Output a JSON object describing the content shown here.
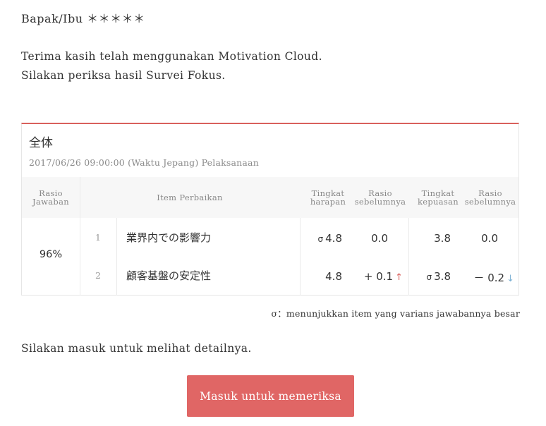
{
  "greeting": "Bapak/Ibu ＊＊＊＊＊",
  "intro": {
    "line1": "Terima kasih telah menggunakan Motivation Cloud.",
    "line2": "Silakan periksa hasil Survei Fokus."
  },
  "card": {
    "title": "全体",
    "date": "2017/06/26 09:00:00 (Waktu Jepang) Pelaksanaan",
    "headers": {
      "rate": [
        "Rasio",
        "Jawaban"
      ],
      "item": "Item Perbaikan",
      "expectation": [
        "Tingkat",
        "harapan"
      ],
      "prev1": [
        "Rasio",
        "sebelumnya"
      ],
      "satisfaction": [
        "Tingkat",
        "kepuasan"
      ],
      "prev2": [
        "Rasio",
        "sebelumnya"
      ]
    },
    "response_rate": "96%",
    "rows": [
      {
        "num": "1",
        "name": "業界内での影響力",
        "expectation_sigma": "σ",
        "expectation": "4.8",
        "prev_expectation": "0.0",
        "prev_expectation_arrow": "",
        "satisfaction_sigma": "",
        "satisfaction": "3.8",
        "prev_satisfaction": "0.0",
        "prev_satisfaction_arrow": ""
      },
      {
        "num": "2",
        "name": "顧客基盤の安定性",
        "expectation_sigma": "",
        "expectation": "4.8",
        "prev_expectation": "+ 0.1",
        "prev_expectation_arrow": "↑",
        "satisfaction_sigma": "σ",
        "satisfaction": "3.8",
        "prev_satisfaction": "－ 0.2",
        "prev_satisfaction_arrow": "↓"
      }
    ],
    "note": "σ：menunjukkan item yang varians jawabannya besar"
  },
  "cta": {
    "text": "Silakan masuk untuk melihat detailnya.",
    "button": "Masuk untuk memeriksa"
  },
  "colors": {
    "accent": "#e06665",
    "card_top_border": "#d9605c",
    "up_arrow": "#d9605c",
    "down_arrow": "#7fb3d5"
  }
}
